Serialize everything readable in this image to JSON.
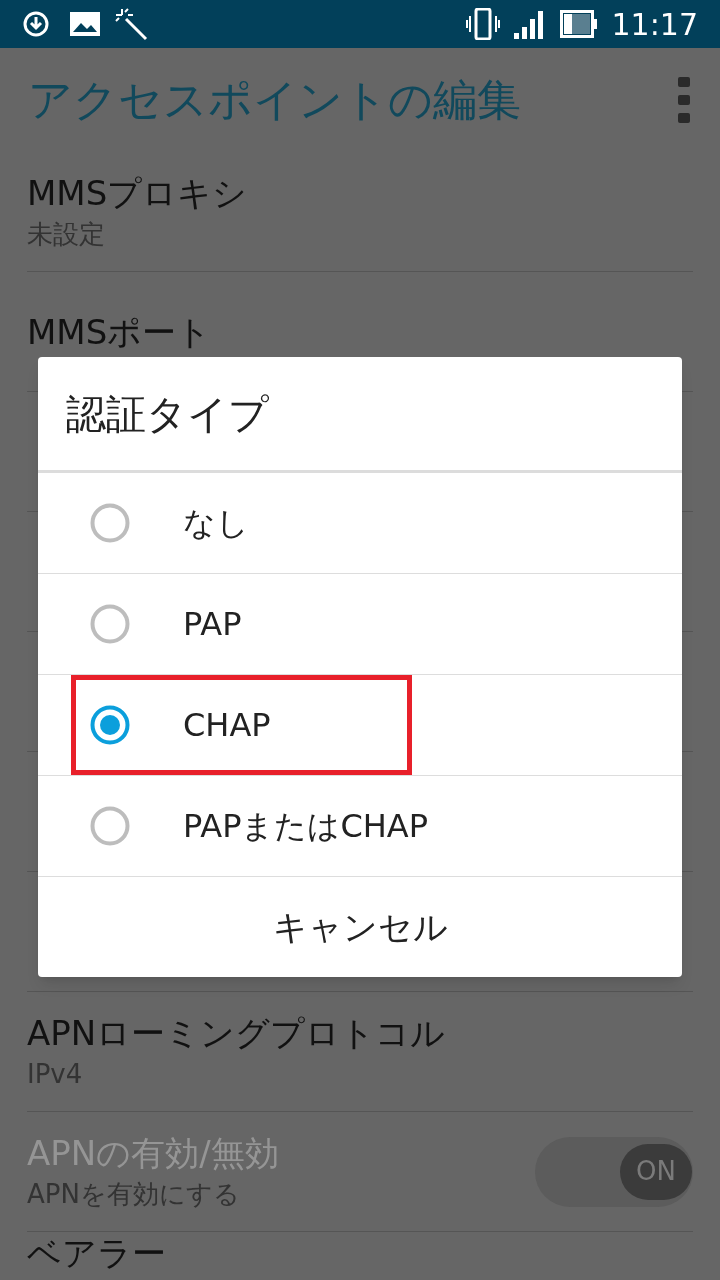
{
  "status_bar": {
    "time": "11:17"
  },
  "app_bar": {
    "title": "アクセスポイントの編集"
  },
  "settings": [
    {
      "title": "MMSプロキシ",
      "summary": "未設定"
    },
    {
      "title": "MMSポート"
    }
  ],
  "settings_below": [
    {
      "title": "APNローミングプロトコル",
      "summary": "IPv4"
    },
    {
      "title": "APNの有効/無効",
      "summary": "APNを有効にする",
      "disabled": true,
      "toggle": {
        "label": "ON",
        "on": true
      }
    },
    {
      "title": "ベアラー"
    }
  ],
  "dialog": {
    "title": "認証タイプ",
    "options": [
      {
        "label": "なし",
        "selected": false,
        "highlighted": false
      },
      {
        "label": "PAP",
        "selected": false,
        "highlighted": false
      },
      {
        "label": "CHAP",
        "selected": true,
        "highlighted": true
      },
      {
        "label": "PAPまたはCHAP",
        "selected": false,
        "highlighted": false
      }
    ],
    "cancel": "キャンセル"
  }
}
